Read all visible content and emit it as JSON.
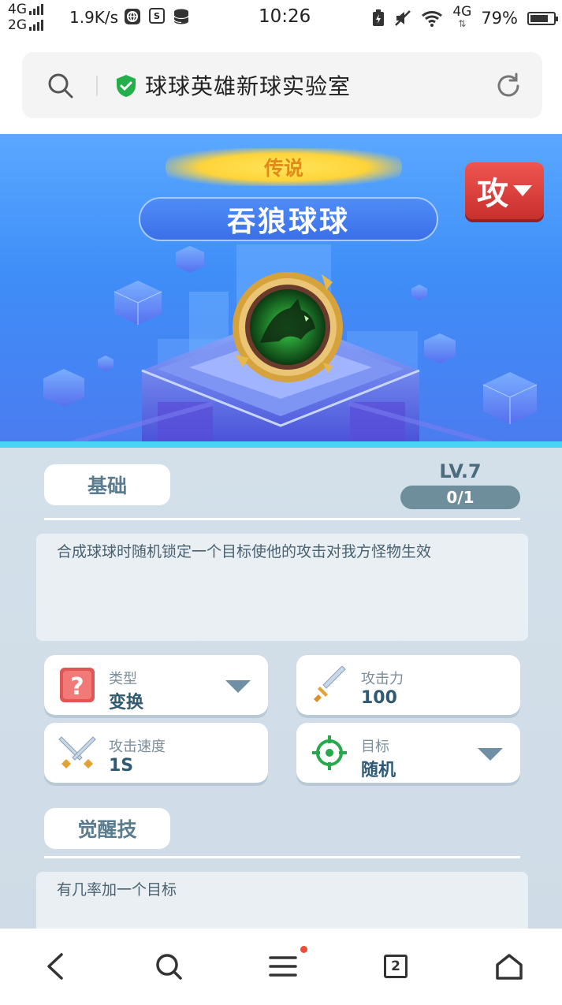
{
  "status_bar": {
    "net_top": "4G",
    "net_bottom": "2G",
    "speed": "1.9K/s",
    "time": "10:26",
    "net_right": "4G",
    "battery": "79%",
    "battery_level": 0.79
  },
  "url_bar": {
    "title": "球球英雄新球实验室"
  },
  "hero": {
    "rarity": "传说",
    "name": "吞狼球球",
    "attack_button_label": "攻"
  },
  "basic": {
    "tab_label": "基础",
    "level": "LV.7",
    "progress": "0/1",
    "description": "合成球球时随机锁定一个目标使他的攻击对我方怪物生效"
  },
  "stats": [
    {
      "label": "类型",
      "value": "变换",
      "icon": "question-box-icon",
      "dropdown": true
    },
    {
      "label": "攻击力",
      "value": "100",
      "icon": "sword-icon",
      "dropdown": false
    },
    {
      "label": "攻击速度",
      "value": "1S",
      "icon": "crossed-swords-icon",
      "dropdown": false
    },
    {
      "label": "目标",
      "value": "随机",
      "icon": "crosshair-icon",
      "dropdown": true
    }
  ],
  "awaken": {
    "tab_label": "觉醒技",
    "description": "有几率加一个目标"
  },
  "bottom_nav": {
    "tab_count": "2"
  },
  "colors": {
    "accent_red": "#d8393a",
    "hero_blue": "#3f8ef8",
    "panel": "#d3e0ea"
  }
}
